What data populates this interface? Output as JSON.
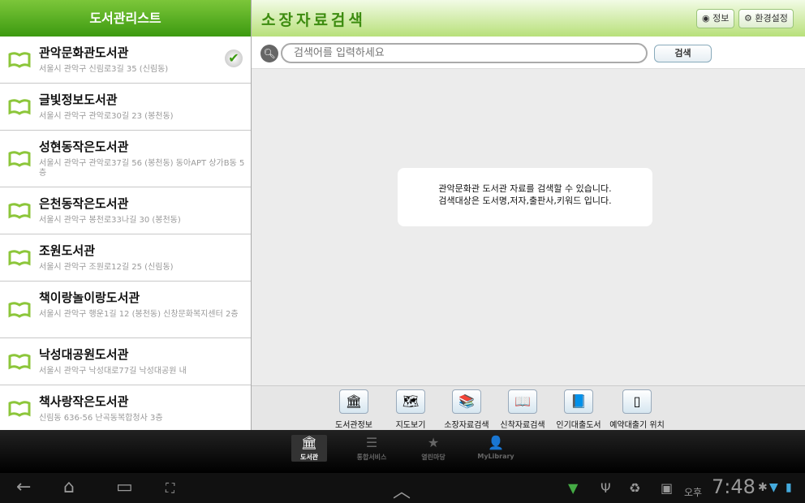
{
  "sidebar": {
    "title": "도서관리스트",
    "items": [
      {
        "name": "관악문화관도서관",
        "address": "서울시 관악구 신림로3길 35 (신림동)",
        "selected": true
      },
      {
        "name": "글빛정보도서관",
        "address": "서울시 관악구 관악로30길 23 (봉천동)"
      },
      {
        "name": "성현동작은도서관",
        "address": "서울시 관악구 관악로37길 56 (봉천동) 동아APT 상가B동 5층"
      },
      {
        "name": "은천동작은도서관",
        "address": "서울시 관악구 봉천로33나길 30 (봉천동)"
      },
      {
        "name": "조원도서관",
        "address": "서울시 관악구 조원로12길 25 (신림동)"
      },
      {
        "name": "책이랑놀이랑도서관",
        "address": "서울시 관악구 행운1길 12 (봉천동) 신창문화복지센터 2층"
      },
      {
        "name": "낙성대공원도서관",
        "address": "서울시 관악구 낙성대로77길 낙성대공원 내"
      },
      {
        "name": "책사랑작은도서관",
        "address": "신림동 636-56 난곡동복합청사 3층"
      }
    ]
  },
  "header": {
    "title": "소장자료검색",
    "info_label": "정보",
    "settings_label": "환경설정"
  },
  "search": {
    "placeholder": "검색어를 입력하세요",
    "button": "검색"
  },
  "message": {
    "line1": "관악문화관 도서관 자료를 검색할 수 있습니다.",
    "line2": "검색대상은 도서명,저자,출판사,키워드 입니다."
  },
  "tools": [
    {
      "label": "도서관정보",
      "icon": "library-icon"
    },
    {
      "label": "지도보기",
      "icon": "map-icon"
    },
    {
      "label": "소장자료검색",
      "icon": "books-search-icon"
    },
    {
      "label": "신착자료검색",
      "icon": "new-book-icon"
    },
    {
      "label": "인기대출도서",
      "icon": "popular-book-icon"
    },
    {
      "label": "예약대출기 위치",
      "icon": "kiosk-icon"
    }
  ],
  "tabs": [
    {
      "label": "도서관",
      "selected": true
    },
    {
      "label": "통합서비스"
    },
    {
      "label": "열린마당"
    },
    {
      "label": "MyLibrary"
    }
  ],
  "status": {
    "ampm": "오후",
    "time": "7:48"
  },
  "colors": {
    "accent": "#4aa41a"
  }
}
